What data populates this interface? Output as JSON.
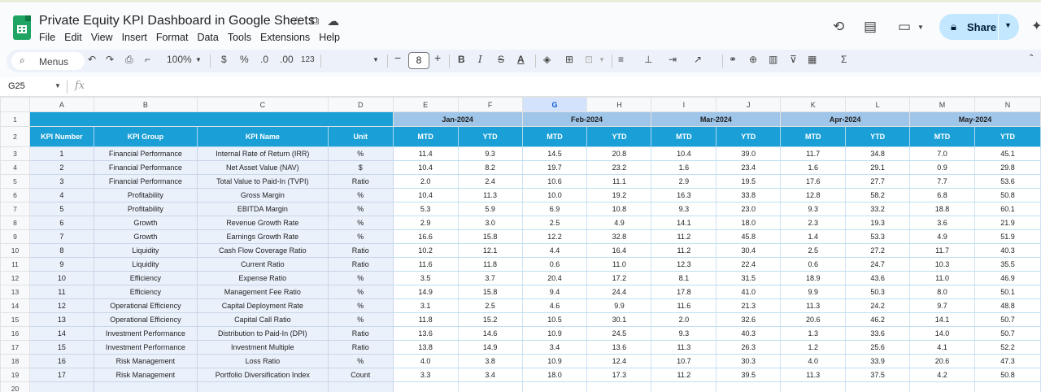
{
  "app": {
    "title": "Private Equity KPI Dashboard in Google Sheets",
    "menu": [
      "File",
      "Edit",
      "View",
      "Insert",
      "Format",
      "Data",
      "Tools",
      "Extensions",
      "Help"
    ],
    "share_label": "Share",
    "accent_color": "#c2e7ff",
    "sheet_icon_color": "#1fa463"
  },
  "toolbar": {
    "menus_label": "Menus",
    "zoom": "100%",
    "currency": "$",
    "percent": "%",
    "dec_decrease": ".0",
    "dec_increase": ".00",
    "number_format": "123",
    "font_size": "8"
  },
  "formula_bar": {
    "cell_ref": "G25",
    "fx": "fx"
  },
  "grid": {
    "columns": [
      "A",
      "B",
      "C",
      "D",
      "E",
      "F",
      "G",
      "H",
      "I",
      "J",
      "K",
      "L",
      "M",
      "N"
    ],
    "selected_column": "G",
    "months": [
      "Jan-2024",
      "Feb-2024",
      "Mar-2024",
      "Apr-2024",
      "May-2024"
    ],
    "headers": [
      "KPI Number",
      "KPI Group",
      "KPI Name",
      "Unit",
      "MTD",
      "YTD",
      "MTD",
      "YTD",
      "MTD",
      "YTD",
      "MTD",
      "YTD",
      "MTD",
      "YTD"
    ],
    "header_color": "#1aa0d6",
    "month_band_color": "#9fc5e8",
    "rows": [
      [
        "1",
        "Financial Performance",
        "Internal Rate of Return (IRR)",
        "%",
        "11.4",
        "9.3",
        "14.5",
        "20.8",
        "10.4",
        "39.0",
        "11.7",
        "34.8",
        "7.0",
        "45.1"
      ],
      [
        "2",
        "Financial Performance",
        "Net Asset Value (NAV)",
        "$",
        "10.4",
        "8.2",
        "19.7",
        "23.2",
        "1.6",
        "23.4",
        "1.6",
        "29.1",
        "0.9",
        "29.8"
      ],
      [
        "3",
        "Financial Performance",
        "Total Value to Paid-In (TVPI)",
        "Ratio",
        "2.0",
        "2.4",
        "10.6",
        "11.1",
        "2.9",
        "19.5",
        "17.6",
        "27.7",
        "7.7",
        "53.6"
      ],
      [
        "4",
        "Profitability",
        "Gross Margin",
        "%",
        "10.4",
        "11.3",
        "10.0",
        "19.2",
        "16.3",
        "33.8",
        "12.8",
        "58.2",
        "6.8",
        "50.8"
      ],
      [
        "5",
        "Profitability",
        "EBITDA Margin",
        "%",
        "5.3",
        "5.9",
        "6.9",
        "10.8",
        "9.3",
        "23.0",
        "9.3",
        "33.2",
        "18.8",
        "60.1"
      ],
      [
        "6",
        "Growth",
        "Revenue Growth Rate",
        "%",
        "2.9",
        "3.0",
        "2.5",
        "4.9",
        "14.1",
        "18.0",
        "2.3",
        "19.3",
        "3.6",
        "21.9"
      ],
      [
        "7",
        "Growth",
        "Earnings Growth Rate",
        "%",
        "16.6",
        "15.8",
        "12.2",
        "32.8",
        "11.2",
        "45.8",
        "1.4",
        "53.3",
        "4.9",
        "51.9"
      ],
      [
        "8",
        "Liquidity",
        "Cash Flow Coverage Ratio",
        "Ratio",
        "10.2",
        "12.1",
        "4.4",
        "16.4",
        "11.2",
        "30.4",
        "2.5",
        "27.2",
        "11.7",
        "40.3"
      ],
      [
        "9",
        "Liquidity",
        "Current Ratio",
        "Ratio",
        "11.6",
        "11.8",
        "0.6",
        "11.0",
        "12.3",
        "22.4",
        "0.6",
        "24.7",
        "10.3",
        "35.5"
      ],
      [
        "10",
        "Efficiency",
        "Expense Ratio",
        "%",
        "3.5",
        "3.7",
        "20.4",
        "17.2",
        "8.1",
        "31.5",
        "18.9",
        "43.6",
        "11.0",
        "46.9"
      ],
      [
        "11",
        "Efficiency",
        "Management Fee Ratio",
        "%",
        "14.9",
        "15.8",
        "9.4",
        "24.4",
        "17.8",
        "41.0",
        "9.9",
        "50.3",
        "8.0",
        "50.1"
      ],
      [
        "12",
        "Operational Efficiency",
        "Capital Deployment Rate",
        "%",
        "3.1",
        "2.5",
        "4.6",
        "9.9",
        "11.6",
        "21.3",
        "11.3",
        "24.2",
        "9.7",
        "48.8"
      ],
      [
        "13",
        "Operational Efficiency",
        "Capital Call Ratio",
        "%",
        "11.8",
        "15.2",
        "10.5",
        "30.1",
        "2.0",
        "32.6",
        "20.6",
        "46.2",
        "14.1",
        "50.7"
      ],
      [
        "14",
        "Investment Performance",
        "Distribution to Paid-In (DPI)",
        "Ratio",
        "13.6",
        "14.6",
        "10.9",
        "24.5",
        "9.3",
        "40.3",
        "1.3",
        "33.6",
        "14.0",
        "50.7"
      ],
      [
        "15",
        "Investment Performance",
        "Investment Multiple",
        "Ratio",
        "13.8",
        "14.9",
        "3.4",
        "13.6",
        "11.3",
        "26.3",
        "1.2",
        "25.6",
        "4.1",
        "52.2"
      ],
      [
        "16",
        "Risk Management",
        "Loss Ratio",
        "%",
        "4.0",
        "3.8",
        "10.9",
        "12.4",
        "10.7",
        "30.3",
        "4.0",
        "33.9",
        "20.6",
        "47.3"
      ],
      [
        "17",
        "Risk Management",
        "Portfolio Diversification Index",
        "Count",
        "3.3",
        "3.4",
        "18.0",
        "17.3",
        "11.2",
        "39.5",
        "11.3",
        "37.5",
        "4.2",
        "50.8"
      ]
    ],
    "row_numbers": [
      "1",
      "2",
      "3",
      "4",
      "5",
      "6",
      "7",
      "8",
      "9",
      "10",
      "11",
      "12",
      "13",
      "14",
      "15",
      "16",
      "17",
      "18",
      "19",
      "20"
    ]
  }
}
